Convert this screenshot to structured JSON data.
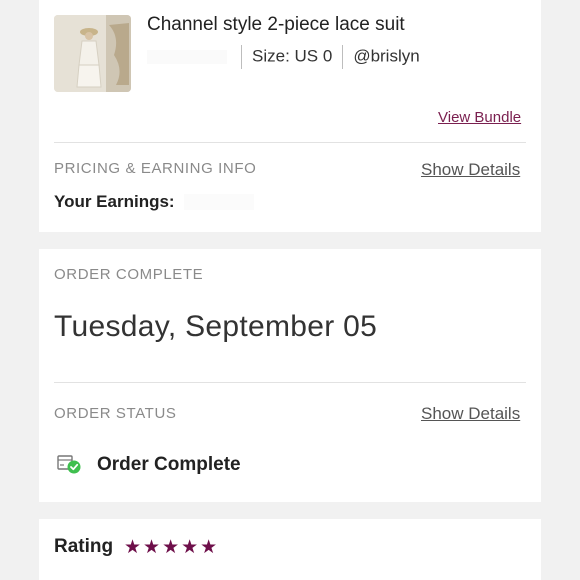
{
  "item": {
    "title": "Channel style 2-piece lace suit",
    "size": "Size: US 0",
    "seller": "@brislyn",
    "view_bundle_label": "View Bundle"
  },
  "pricing": {
    "label": "PRICING & EARNING INFO",
    "show_details_label": "Show Details",
    "earnings_label": "Your Earnings:"
  },
  "order_complete": {
    "label": "ORDER COMPLETE",
    "date": "Tuesday, September 05"
  },
  "order_status": {
    "label": "ORDER STATUS",
    "show_details_label": "Show Details",
    "status_text": "Order Complete",
    "icon": "box-check-icon"
  },
  "rating": {
    "label": "Rating",
    "stars": 5,
    "star_glyphs": "★★★★★"
  },
  "colors": {
    "accent": "#6e0f4a",
    "link": "#7a1f4f",
    "success": "#3fbf4f"
  }
}
